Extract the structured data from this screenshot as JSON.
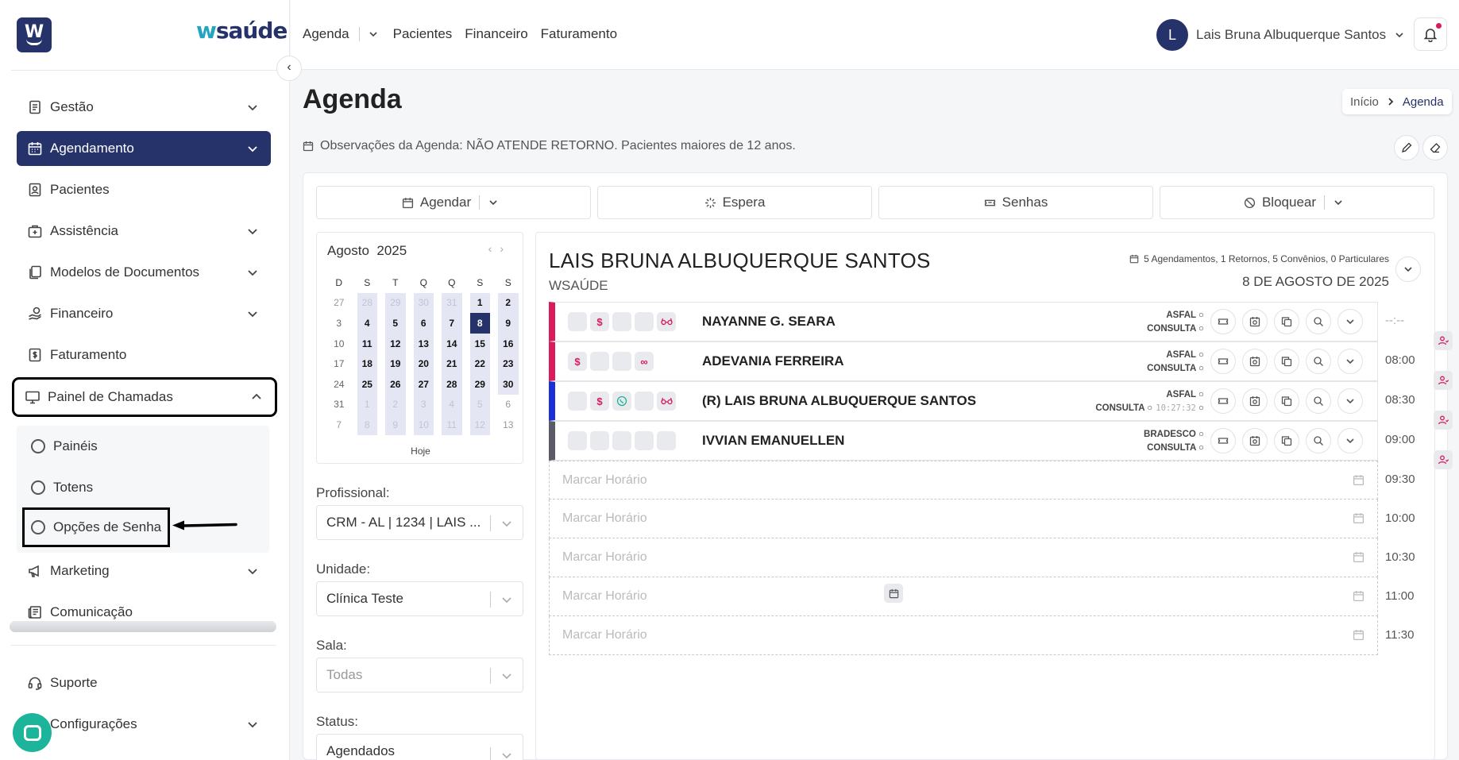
{
  "brand": {
    "logo_letter": "W",
    "name_prefix": "w",
    "name_rest": "saúde"
  },
  "sidebar": {
    "items": [
      {
        "label": "Gestão"
      },
      {
        "label": "Agendamento"
      },
      {
        "label": "Pacientes"
      },
      {
        "label": "Assistência"
      },
      {
        "label": "Modelos de Documentos"
      },
      {
        "label": "Financeiro"
      },
      {
        "label": "Faturamento"
      },
      {
        "label": "Painel de Chamadas"
      },
      {
        "label": "Marketing"
      },
      {
        "label": "Comunicação"
      },
      {
        "label": "Suporte"
      },
      {
        "label": "Configurações"
      }
    ],
    "submenu": [
      {
        "label": "Painéis"
      },
      {
        "label": "Totens"
      },
      {
        "label": "Opções de Senha"
      }
    ]
  },
  "topbar": {
    "nav": [
      "Agenda",
      "Pacientes",
      "Financeiro",
      "Faturamento"
    ],
    "user_initial": "L",
    "user_name": "Lais Bruna Albuquerque Santos"
  },
  "page": {
    "title": "Agenda",
    "breadcrumb": [
      "Início",
      "Agenda"
    ],
    "observations": "Observações da Agenda: NÃO ATENDE RETORNO. Pacientes maiores de 12 anos."
  },
  "actions": [
    "Agendar",
    "Espera",
    "Senhas",
    "Bloquear"
  ],
  "calendar": {
    "month": "Agosto",
    "year": "2025",
    "weekdays": [
      "D",
      "S",
      "T",
      "Q",
      "Q",
      "S",
      "S"
    ],
    "weeks": [
      [
        "27",
        "28",
        "29",
        "30",
        "31",
        "1",
        "2"
      ],
      [
        "3",
        "4",
        "5",
        "6",
        "7",
        "8",
        "9"
      ],
      [
        "10",
        "11",
        "12",
        "13",
        "14",
        "15",
        "16"
      ],
      [
        "17",
        "18",
        "19",
        "20",
        "21",
        "22",
        "23"
      ],
      [
        "24",
        "25",
        "26",
        "27",
        "28",
        "29",
        "30"
      ],
      [
        "31",
        "1",
        "2",
        "3",
        "4",
        "5",
        "6"
      ],
      [
        "7",
        "8",
        "9",
        "10",
        "11",
        "12",
        "13"
      ]
    ],
    "today_label": "Hoje"
  },
  "filters": {
    "profissional": {
      "label": "Profissional:",
      "value": "CRM - AL | 1234 | LAIS ..."
    },
    "unidade": {
      "label": "Unidade:",
      "value": "Clínica Teste"
    },
    "sala": {
      "label": "Sala:",
      "value": "Todas"
    },
    "status": {
      "label": "Status:",
      "value": "Agendados"
    }
  },
  "schedule": {
    "doctor": "LAIS BRUNA ALBUQUERQUE SANTOS",
    "org": "WSAÚDE",
    "stats": "5 Agendamentos, 1 Retornos, 5 Convênios, 0 Particulares",
    "date": "8 DE AGOSTO DE 2025",
    "appointments": [
      {
        "name": "NAYANNE G. SEARA",
        "insurance": "ASFAL",
        "type": "CONSULTA",
        "timestamp": "",
        "time": "--:--",
        "color": "#d91b5c"
      },
      {
        "name": "ADEVANIA FERREIRA",
        "insurance": "ASFAL",
        "type": "CONSULTA",
        "timestamp": "",
        "time": "08:00",
        "color": "#d91b5c"
      },
      {
        "name": "(R) LAIS BRUNA ALBUQUERQUE SANTOS",
        "insurance": "ASFAL",
        "type": "CONSULTA",
        "timestamp": "10:27:32",
        "time": "08:30",
        "color": "#1a2fd6"
      },
      {
        "name": "IVVIAN EMANUELLEN",
        "insurance": "BRADESCO",
        "type": "CONSULTA",
        "timestamp": "",
        "time": "09:00",
        "color": "#5b5b68"
      }
    ],
    "empty_slot_label": "Marcar Horário",
    "empty_slots": [
      "09:30",
      "10:00",
      "10:30",
      "11:00",
      "11:30"
    ]
  }
}
